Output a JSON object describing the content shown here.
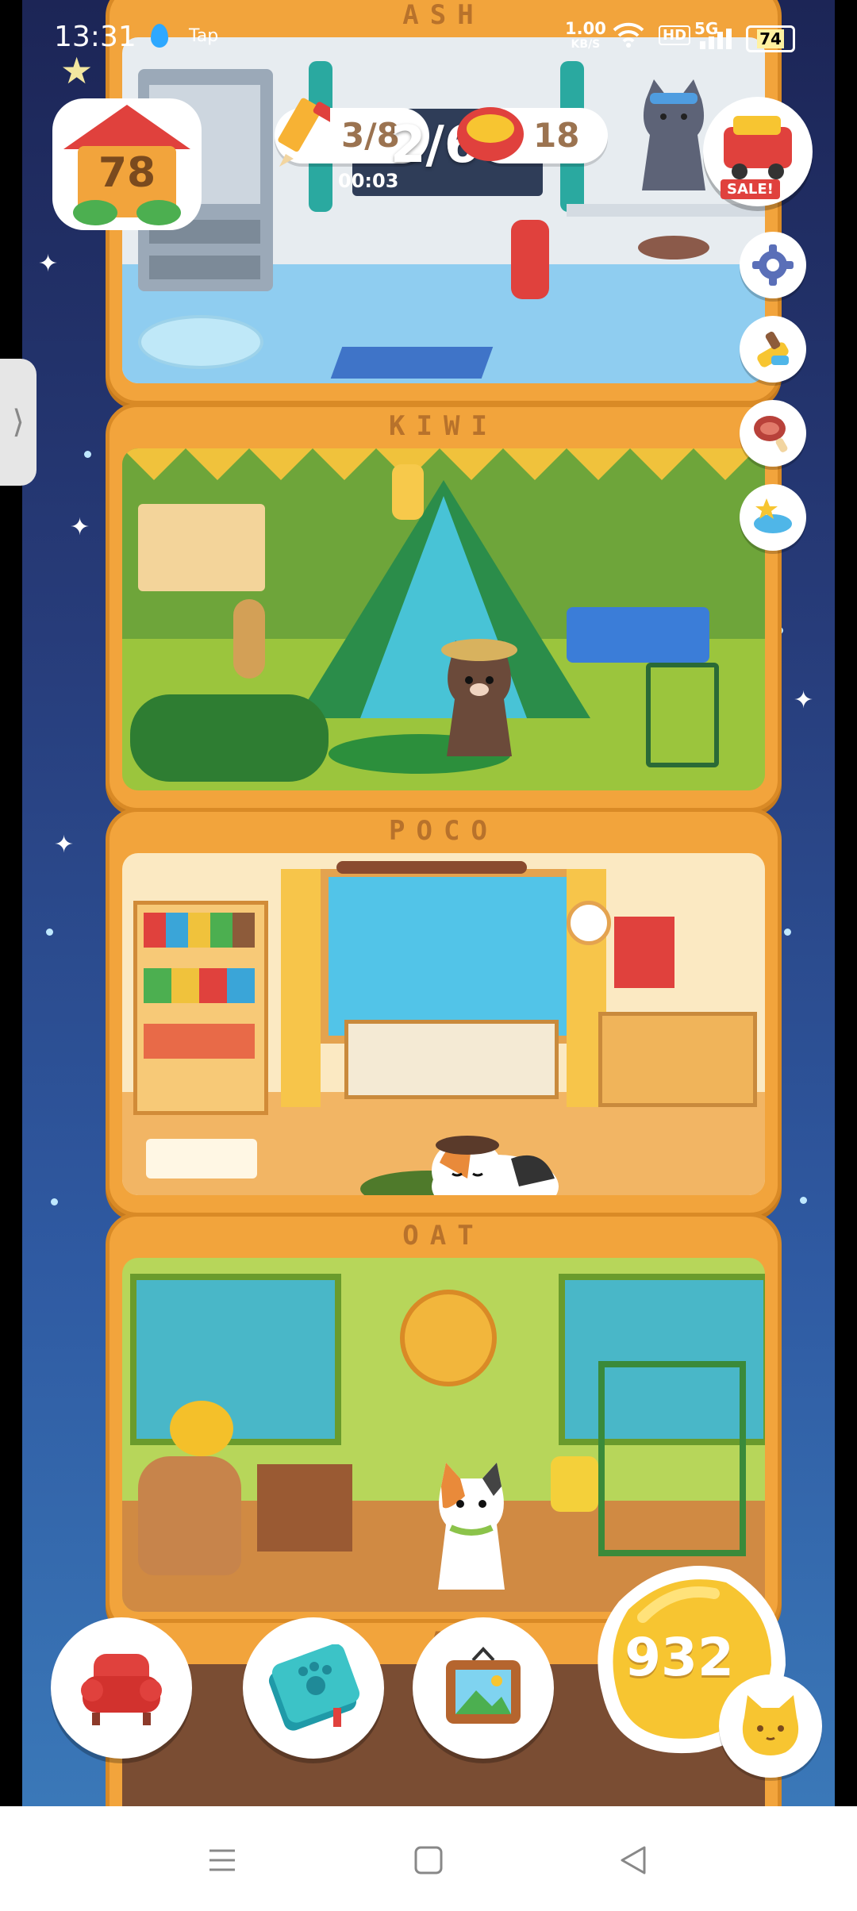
{
  "status_bar": {
    "time": "13:31",
    "notification_app": "Tap",
    "net_speed_value": "1.00",
    "net_speed_unit": "KB/S",
    "hd_badge": "HD",
    "signal_label": "5G",
    "battery": "74"
  },
  "hud": {
    "house_level": "78",
    "pencil_counter": "3/8",
    "pencil_timer": "00:03",
    "page_indicator": "2/6",
    "cans_counter": "18",
    "shop_badge": "SALE!",
    "coins": "932"
  },
  "rooms": [
    {
      "name": "ASH"
    },
    {
      "name": "KIWI"
    },
    {
      "name": "POCO"
    },
    {
      "name": "OAT"
    },
    {
      "name": "A"
    }
  ],
  "side_buttons": [
    "gear-icon",
    "brush-icon",
    "meat-icon",
    "star-plate-icon"
  ],
  "bottom_buttons": [
    "armchair-icon",
    "paw-notebook-icon",
    "picture-frame-icon"
  ],
  "colors": {
    "sky_top": "#1c2556",
    "sky_bottom": "#3a78b8",
    "building": "#f2a43c",
    "coin": "#f7c531"
  }
}
